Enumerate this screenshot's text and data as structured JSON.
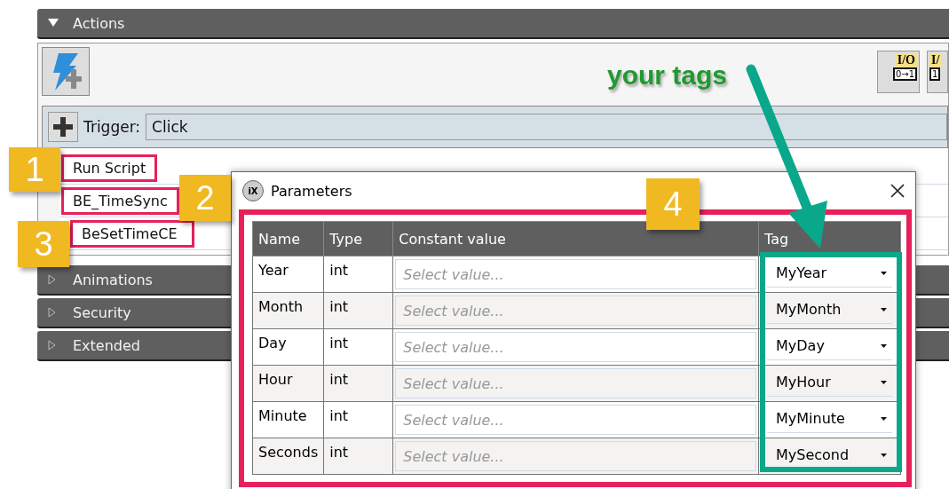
{
  "actions": {
    "title": "Actions",
    "expanded": true,
    "tools": [
      {
        "label": "I/O",
        "caption": "0→1"
      },
      {
        "label": "I/",
        "caption": "1"
      }
    ],
    "trigger": {
      "label": "Trigger:",
      "value": "Click"
    },
    "items": [
      {
        "text": "Run Script",
        "highlighted": true
      },
      {
        "text": "BE_TimeSync",
        "highlighted": true
      },
      {
        "text": "BeSetTimeCE",
        "highlighted": true
      }
    ]
  },
  "sections": [
    {
      "title": "Animations",
      "expanded": false
    },
    {
      "title": "Security",
      "expanded": false
    },
    {
      "title": "Extended",
      "expanded": false
    }
  ],
  "dialog": {
    "icon": "iX",
    "title": "Parameters",
    "highlighted": true,
    "columns": [
      "Name",
      "Type",
      "Constant value",
      "Tag"
    ],
    "rows": [
      {
        "name": "Year",
        "type": "int",
        "placeholder": "Select value...",
        "tag": "MyYear"
      },
      {
        "name": "Month",
        "type": "int",
        "placeholder": "Select value...",
        "tag": "MyMonth"
      },
      {
        "name": "Day",
        "type": "int",
        "placeholder": "Select value...",
        "tag": "MyDay"
      },
      {
        "name": "Hour",
        "type": "int",
        "placeholder": "Select value...",
        "tag": "MyHour"
      },
      {
        "name": "Minute",
        "type": "int",
        "placeholder": "Select value...",
        "tag": "MyMinute"
      },
      {
        "name": "Seconds",
        "type": "int",
        "placeholder": "Select value...",
        "tag": "MySecond"
      }
    ]
  },
  "annotations": {
    "callouts": [
      "1",
      "2",
      "3",
      "4"
    ],
    "note": "your tags"
  }
}
